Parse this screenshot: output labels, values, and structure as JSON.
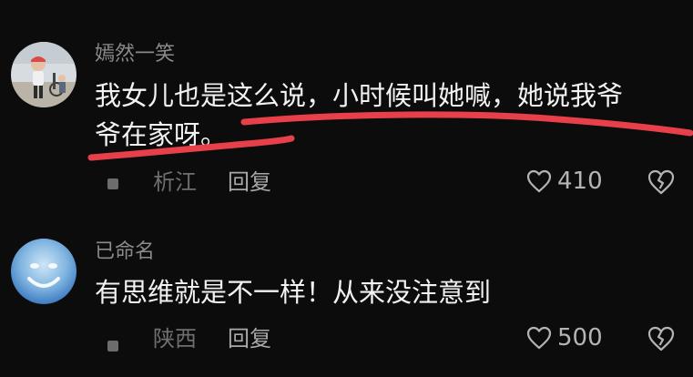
{
  "comments": [
    {
      "username": "嫣然一笑",
      "text_line1": "我女儿也是这么说，小时候叫她喊，她说我爷",
      "text_line2": "爷在家呀。",
      "location": "析江",
      "reply_label": "回复",
      "likes": "410"
    },
    {
      "username": "已命名",
      "text_line1": "有思维就是不一样！从来没注意到",
      "location": "陕西",
      "reply_label": "回复",
      "likes": "500"
    }
  ],
  "colors": {
    "background": "#0c0c0c",
    "annotation": "#e8404a",
    "text": "#f2f2f2",
    "muted": "#8a8a8a"
  },
  "icons": {
    "like": "heart-outline-icon",
    "dislike": "broken-heart-icon"
  }
}
